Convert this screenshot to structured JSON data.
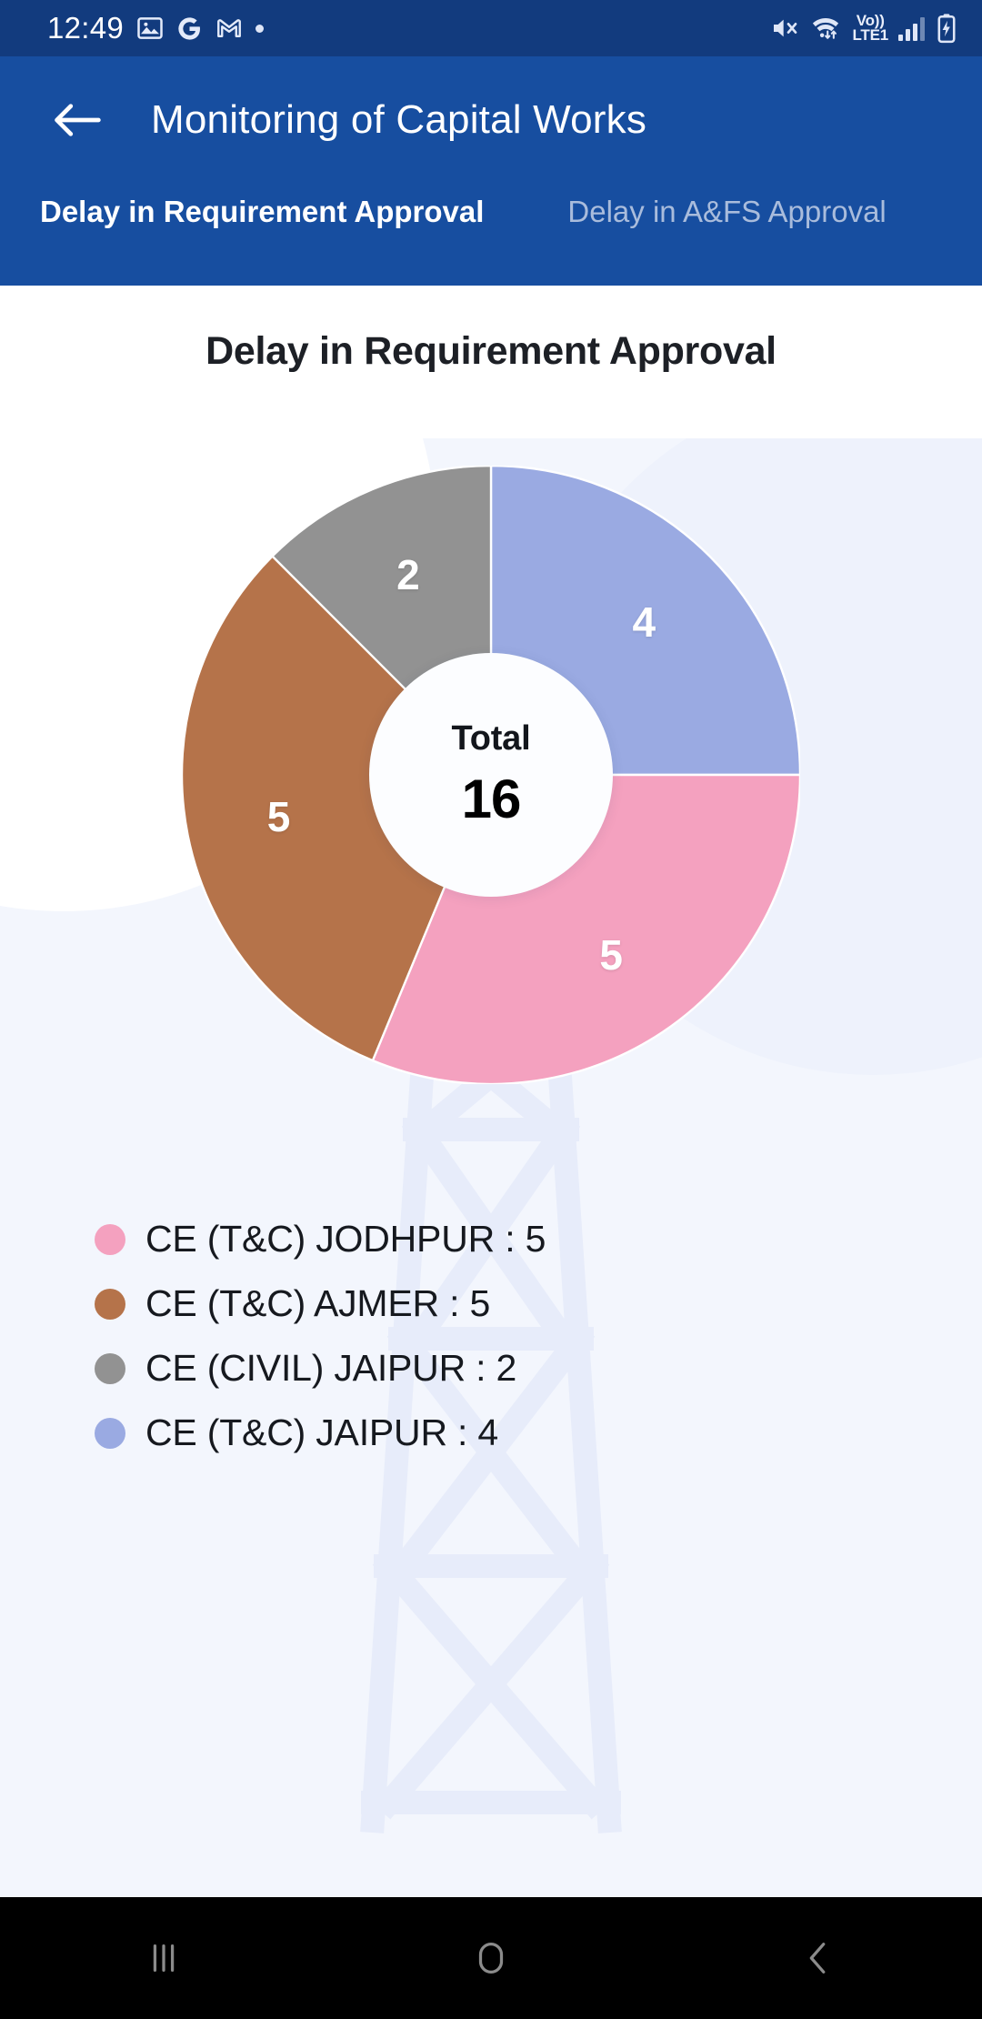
{
  "status_bar": {
    "time": "12:49",
    "left_icons": [
      "photos-icon",
      "google-icon",
      "gmail-icon",
      "dot-icon"
    ],
    "right_icons": [
      "mute-icon",
      "wifi-icon",
      "volte-icon",
      "signal-icon",
      "battery-charging-icon"
    ],
    "volte_line1": "Vo))",
    "volte_line2": "LTE1",
    "background": "#123b7e"
  },
  "app_bar": {
    "back_icon": "arrow-left-icon",
    "title": "Monitoring of Capital Works",
    "background": "#174ea0"
  },
  "tabs": [
    {
      "label": "Delay in Requirement Approval",
      "active": true
    },
    {
      "label": "Delay in A&FS Approval",
      "active": false
    }
  ],
  "main": {
    "chart_title": "Delay in Requirement Approval",
    "center_label": "Total",
    "center_value": "16"
  },
  "chart_data": {
    "type": "pie",
    "variant": "donut",
    "title": "Delay in Requirement Approval",
    "total": 16,
    "center_label": "Total",
    "start_angle_deg": 0,
    "direction": "clockwise",
    "legend_position": "bottom-left",
    "categories": [
      "CE (T&C) JAIPUR",
      "CE (T&C) JODHPUR",
      "CE (T&C) AJMER",
      "CE (CIVIL) JAIPUR"
    ],
    "values": [
      4,
      5,
      5,
      2
    ],
    "colors": [
      "#9aaae2",
      "#f4a1bf",
      "#b5734a",
      "#929292"
    ],
    "slices": [
      {
        "label": "CE (T&C) JAIPUR",
        "value": 4,
        "color": "#9aaae2",
        "start_deg": 0,
        "sweep_deg": 90
      },
      {
        "label": "CE (T&C) JODHPUR",
        "value": 5,
        "color": "#f4a1bf",
        "start_deg": 90,
        "sweep_deg": 112.5
      },
      {
        "label": "CE (T&C) AJMER",
        "value": 5,
        "color": "#b5734a",
        "start_deg": 202.5,
        "sweep_deg": 112.5
      },
      {
        "label": "CE (CIVIL) JAIPUR",
        "value": 2,
        "color": "#929292",
        "start_deg": 315,
        "sweep_deg": 45
      }
    ],
    "data_labels": [
      "4",
      "5",
      "5",
      "2"
    ]
  },
  "legend": [
    {
      "text": "CE (T&C) JODHPUR : 5",
      "color": "#f4a1bf"
    },
    {
      "text": "CE (T&C) AJMER : 5",
      "color": "#b5734a"
    },
    {
      "text": "CE (CIVIL) JAIPUR : 2",
      "color": "#929292"
    },
    {
      "text": "CE (T&C) JAIPUR : 4",
      "color": "#9aaae2"
    }
  ],
  "nav_bar": {
    "recents_icon": "recents-icon",
    "home_icon": "home-icon",
    "back_icon": "back-chevron-icon"
  }
}
